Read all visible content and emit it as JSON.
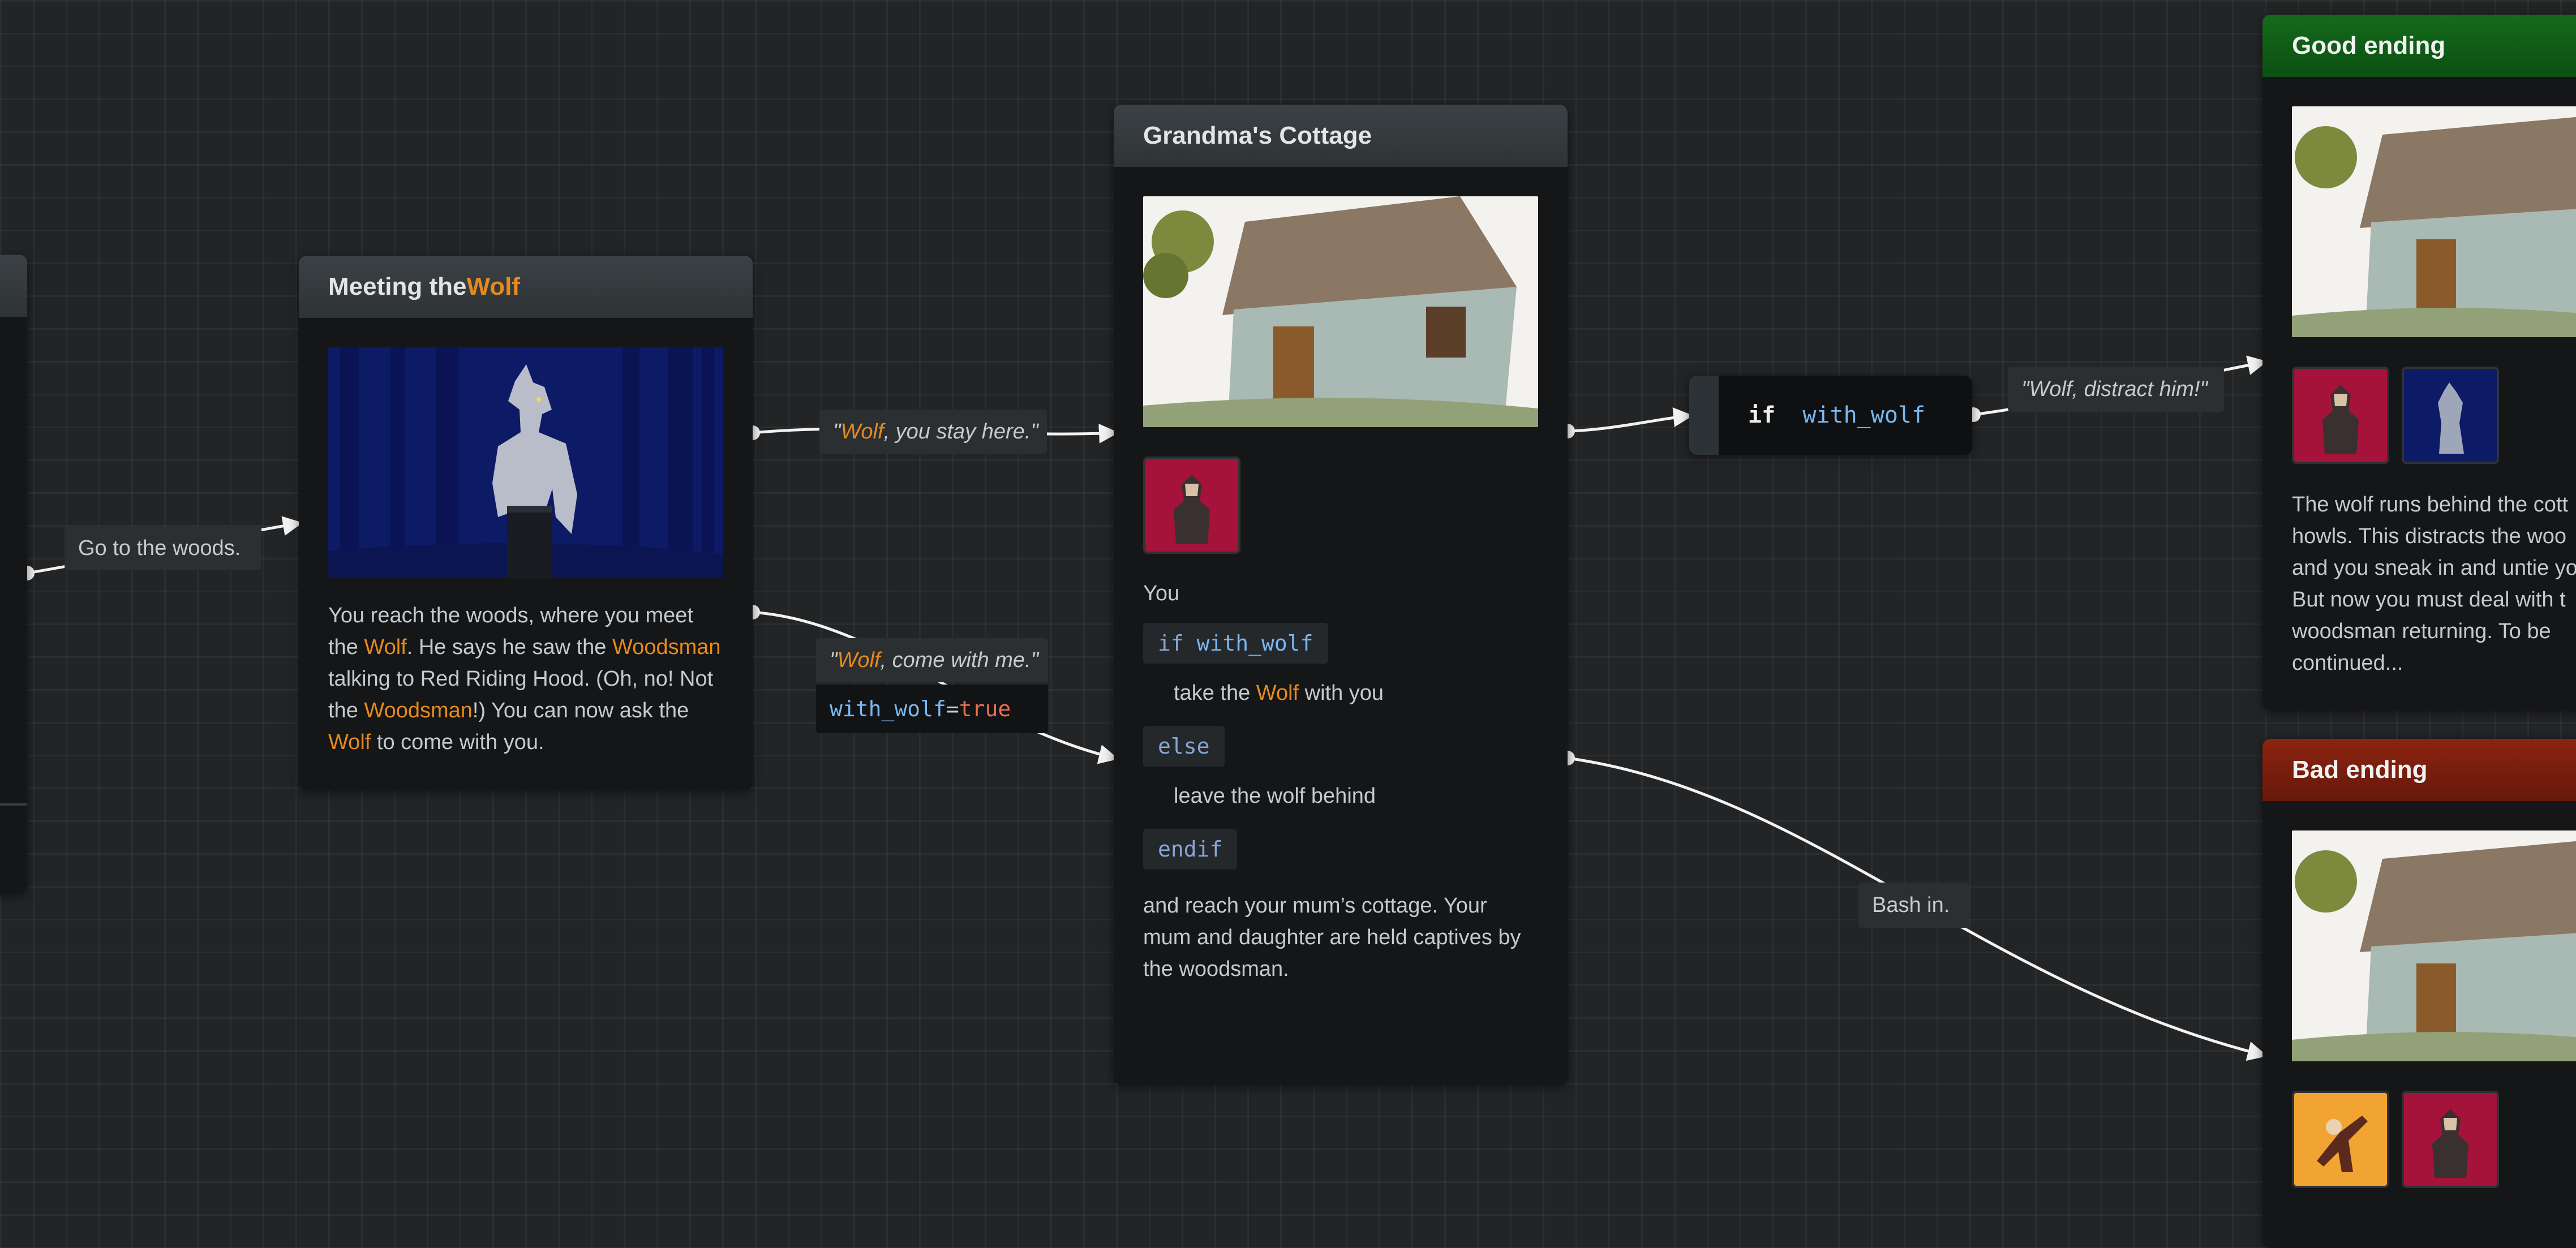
{
  "colors": {
    "background": "#222426",
    "node_body": "#151617",
    "node_header": "#3b4144",
    "highlight": "#e58a1f",
    "good_header": "#146b1b",
    "bad_header": "#8c2410",
    "code_variable": "#79b8f0",
    "code_true": "#e8704f"
  },
  "meeting_wolf": {
    "title_prefix": "Meeting the ",
    "title_highlight": "Wolf",
    "image_icon": "werewolf-portrait",
    "text": {
      "p1": "You reach the woods, where you meet the ",
      "wolf1": "Wolf",
      "p2": ". He says he saw the ",
      "woodsman1": "Woodsman",
      "p3": " talking to Red Riding Hood. (Oh, no! Not the ",
      "woodsman2": "Woodsman",
      "p4": "!) You can now ask the ",
      "wolf2": "Wolf",
      "p5": " to come with you."
    }
  },
  "edge_labels": {
    "go_woods": "Go to the woods.",
    "stay": {
      "q1": "\"",
      "hl": "Wolf",
      "rest": ", you stay here.\""
    },
    "come": {
      "q1": "\"",
      "hl": "Wolf",
      "rest": ", come with me.\""
    },
    "assign": {
      "var": "with_wolf",
      "op": " = ",
      "val": "true"
    },
    "distract": "\"Wolf, distract him!\"",
    "bash": "Bash in."
  },
  "cottage": {
    "title": "Grandma's Cottage",
    "image_icon": "stone-cottage-picture",
    "thumb_icon": "woodsman-portrait",
    "you": "You",
    "if_kw": "if",
    "if_var": "with_wolf",
    "line1": {
      "pre": "take the ",
      "hl": "Wolf",
      "post": " with you"
    },
    "else_kw": "else",
    "line2": "leave the wolf behind",
    "endif_kw": "endif",
    "outro": "and reach your mum’s cottage. Your mum and daughter are held captives by the woodsman."
  },
  "condition": {
    "kw": "if",
    "var": "with_wolf"
  },
  "good_ending": {
    "title": "Good ending",
    "text": "The wolf runs behind the cott howls. This distracts the woo and you sneak in and untie yo But now you must deal with t woodsman returning. To be continued..."
  },
  "bad_ending": {
    "title": "Bad ending"
  }
}
